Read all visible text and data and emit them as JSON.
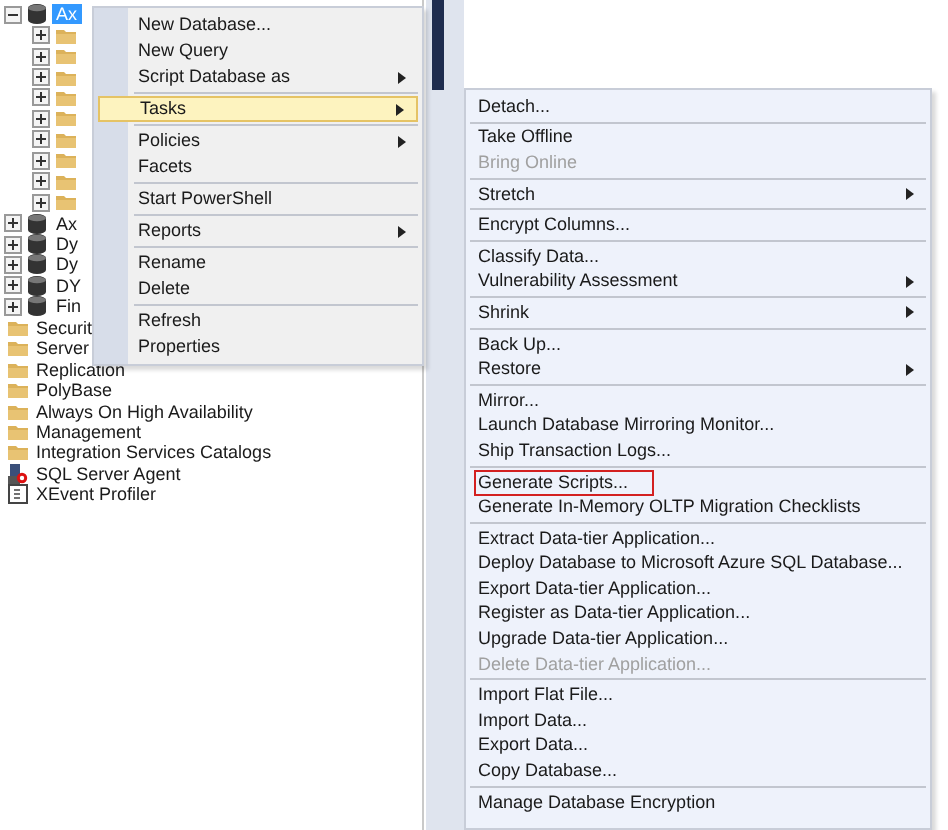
{
  "tree": {
    "nodes": [
      {
        "label": "Ax",
        "kind": "database",
        "expanded": true,
        "selected": true,
        "children": [
          {
            "kind": "folder",
            "expanded": false
          },
          {
            "kind": "folder",
            "expanded": false
          },
          {
            "kind": "folder",
            "expanded": false
          },
          {
            "kind": "folder",
            "expanded": false
          },
          {
            "kind": "folder",
            "expanded": false
          },
          {
            "kind": "folder",
            "expanded": false
          },
          {
            "kind": "folder",
            "expanded": false
          },
          {
            "kind": "folder",
            "expanded": false
          },
          {
            "kind": "folder",
            "expanded": false
          }
        ]
      },
      {
        "label": "Ax",
        "kind": "database",
        "expanded": false,
        "selected": false
      },
      {
        "label": "Dy",
        "kind": "database",
        "expanded": false,
        "selected": false
      },
      {
        "label": "Dy",
        "kind": "database",
        "expanded": false,
        "selected": false
      },
      {
        "label": "DY",
        "kind": "database",
        "expanded": false,
        "selected": false
      },
      {
        "label": "Fin",
        "kind": "database",
        "expanded": false,
        "selected": false
      },
      {
        "label": "Securit",
        "kind": "folder",
        "selected": false
      },
      {
        "label": "Server",
        "kind": "folder",
        "selected": false
      },
      {
        "label": "Replication",
        "kind": "folder",
        "selected": false
      },
      {
        "label": "PolyBase",
        "kind": "folder",
        "selected": false
      },
      {
        "label": "Always On High Availability",
        "kind": "folder",
        "selected": false
      },
      {
        "label": "Management",
        "kind": "folder",
        "selected": false
      },
      {
        "label": "Integration Services Catalogs",
        "kind": "folder",
        "selected": false
      },
      {
        "label": "SQL Server Agent",
        "kind": "agent",
        "selected": false
      },
      {
        "label": "XEvent Profiler",
        "kind": "xevent",
        "selected": false
      }
    ]
  },
  "context_menu": {
    "groups": [
      [
        {
          "label": "New Database...",
          "submenu": false,
          "selected": false
        },
        {
          "label": "New Query",
          "submenu": false,
          "selected": false
        },
        {
          "label": "Script Database as",
          "submenu": true,
          "selected": false
        }
      ],
      [
        {
          "label": "Tasks",
          "submenu": true,
          "selected": true
        }
      ],
      [
        {
          "label": "Policies",
          "submenu": true,
          "selected": false
        },
        {
          "label": "Facets",
          "submenu": false,
          "selected": false
        }
      ],
      [
        {
          "label": "Start PowerShell",
          "submenu": false,
          "selected": false
        }
      ],
      [
        {
          "label": "Reports",
          "submenu": true,
          "selected": false
        }
      ],
      [
        {
          "label": "Rename",
          "submenu": false,
          "selected": false
        },
        {
          "label": "Delete",
          "submenu": false,
          "selected": false
        }
      ],
      [
        {
          "label": "Refresh",
          "submenu": false,
          "selected": false
        },
        {
          "label": "Properties",
          "submenu": false,
          "selected": false
        }
      ]
    ]
  },
  "tasks_submenu": {
    "groups": [
      [
        {
          "label": "Detach...",
          "submenu": false,
          "disabled": false
        }
      ],
      [
        {
          "label": "Take Offline",
          "submenu": false,
          "disabled": false
        },
        {
          "label": "Bring Online",
          "submenu": false,
          "disabled": true
        }
      ],
      [
        {
          "label": "Stretch",
          "submenu": true,
          "disabled": false
        }
      ],
      [
        {
          "label": "Encrypt Columns...",
          "submenu": false,
          "disabled": false
        }
      ],
      [
        {
          "label": "Classify Data...",
          "submenu": false,
          "disabled": false
        },
        {
          "label": "Vulnerability Assessment",
          "submenu": true,
          "disabled": false
        }
      ],
      [
        {
          "label": "Shrink",
          "submenu": true,
          "disabled": false
        }
      ],
      [
        {
          "label": "Back Up...",
          "submenu": false,
          "disabled": false
        },
        {
          "label": "Restore",
          "submenu": true,
          "disabled": false
        }
      ],
      [
        {
          "label": "Mirror...",
          "submenu": false,
          "disabled": false
        },
        {
          "label": "Launch Database Mirroring Monitor...",
          "submenu": false,
          "disabled": false
        },
        {
          "label": "Ship Transaction Logs...",
          "submenu": false,
          "disabled": false
        }
      ],
      [
        {
          "label": "Generate Scripts...",
          "submenu": false,
          "disabled": false,
          "outlined": true
        },
        {
          "label": "Generate In-Memory OLTP Migration Checklists",
          "submenu": false,
          "disabled": false
        }
      ],
      [
        {
          "label": "Extract Data-tier Application...",
          "submenu": false,
          "disabled": false
        },
        {
          "label": "Deploy Database to Microsoft Azure SQL Database...",
          "submenu": false,
          "disabled": false
        },
        {
          "label": "Export Data-tier Application...",
          "submenu": false,
          "disabled": false
        },
        {
          "label": "Register as Data-tier Application...",
          "submenu": false,
          "disabled": false
        },
        {
          "label": "Upgrade Data-tier Application...",
          "submenu": false,
          "disabled": false
        },
        {
          "label": "Delete Data-tier Application...",
          "submenu": false,
          "disabled": true
        }
      ],
      [
        {
          "label": "Import Flat File...",
          "submenu": false,
          "disabled": false
        },
        {
          "label": "Import Data...",
          "submenu": false,
          "disabled": false
        },
        {
          "label": "Export Data...",
          "submenu": false,
          "disabled": false
        },
        {
          "label": "Copy Database...",
          "submenu": false,
          "disabled": false
        }
      ],
      [
        {
          "label": "Manage Database Encryption",
          "submenu": false,
          "disabled": false
        }
      ]
    ]
  }
}
